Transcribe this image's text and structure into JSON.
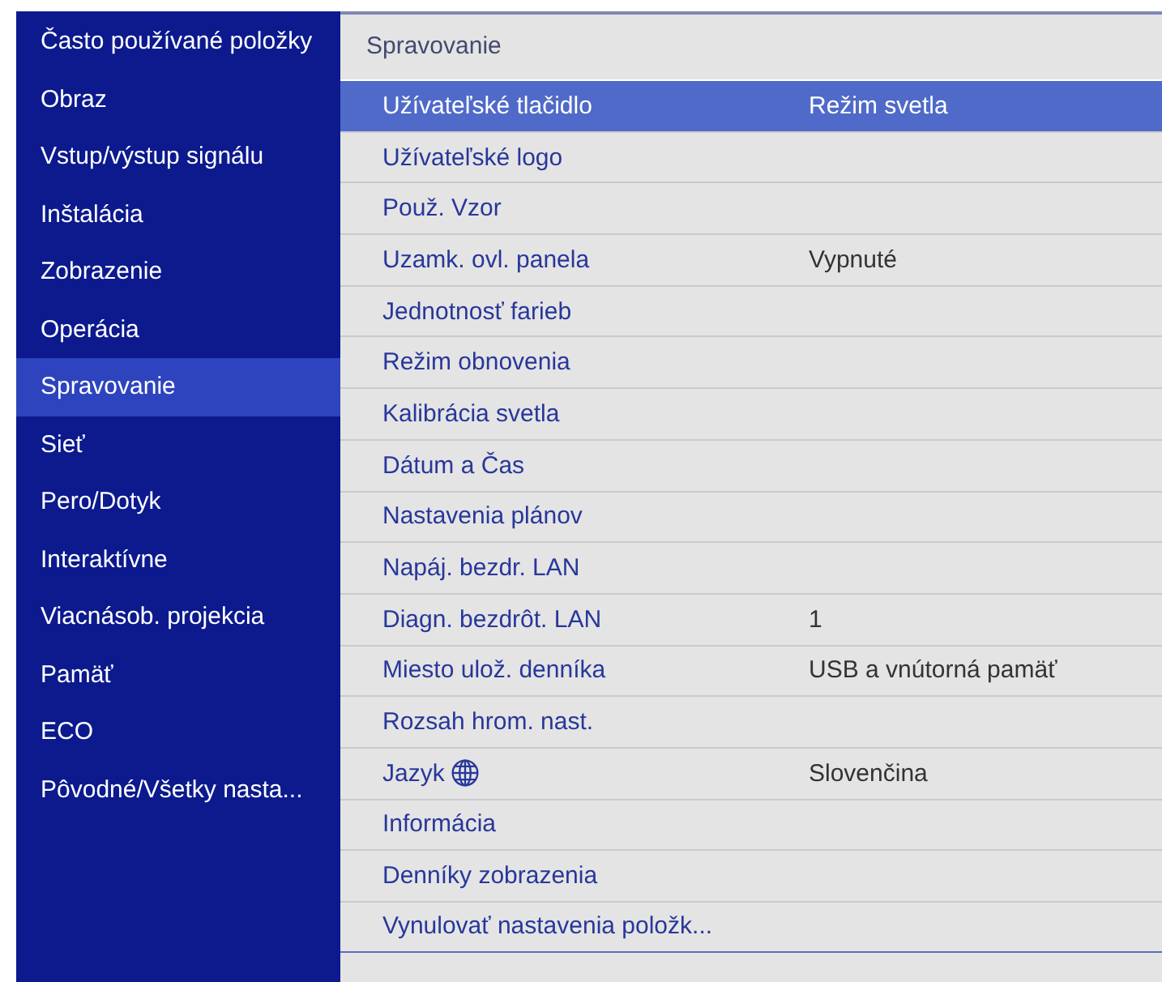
{
  "sidebar": {
    "items": [
      {
        "label": "Často používané položky",
        "selected": false
      },
      {
        "label": "Obraz",
        "selected": false
      },
      {
        "label": "Vstup/výstup signálu",
        "selected": false
      },
      {
        "label": "Inštalácia",
        "selected": false
      },
      {
        "label": "Zobrazenie",
        "selected": false
      },
      {
        "label": "Operácia",
        "selected": false
      },
      {
        "label": "Spravovanie",
        "selected": true
      },
      {
        "label": "Sieť",
        "selected": false
      },
      {
        "label": "Pero/Dotyk",
        "selected": false
      },
      {
        "label": "Interaktívne",
        "selected": false
      },
      {
        "label": "Viacnásob. projekcia",
        "selected": false
      },
      {
        "label": "Pamäť",
        "selected": false
      },
      {
        "label": "ECO",
        "selected": false
      },
      {
        "label": "Pôvodné/Všetky nasta...",
        "selected": false
      }
    ]
  },
  "panel": {
    "title": "Spravovanie",
    "rows": [
      {
        "kind": "plain",
        "label": "Užívateľské tlačidlo",
        "value": "Režim svetla",
        "selected": true
      },
      {
        "kind": "plain",
        "label": "Užívateľské logo",
        "selected": false
      },
      {
        "kind": "plain",
        "label": "Použ. Vzor",
        "selected": false
      },
      {
        "kind": "plain",
        "label": "Uzamk. ovl. panela",
        "value": "Vypnuté",
        "selected": false
      },
      {
        "kind": "plain",
        "label": "Jednotnosť farieb",
        "selected": false
      },
      {
        "kind": "plain",
        "label": "Režim obnovenia",
        "selected": false
      },
      {
        "kind": "plain",
        "label": "Kalibrácia svetla",
        "selected": false
      },
      {
        "kind": "plain",
        "label": "Dátum a Čas",
        "selected": false
      },
      {
        "kind": "plain",
        "label": "Nastavenia plánov",
        "selected": false
      },
      {
        "kind": "plain",
        "label": "Napáj. bezdr. LAN",
        "selected": false
      },
      {
        "kind": "plain",
        "label": "Diagn. bezdrôt. LAN",
        "value": "1",
        "selected": false
      },
      {
        "kind": "plain",
        "label": "Miesto ulož. denníka",
        "value": "USB a vnútorná pamäť",
        "selected": false
      },
      {
        "kind": "plain",
        "label": "Rozsah hrom. nast.",
        "selected": false
      },
      {
        "kind": "language",
        "label": "Jazyk",
        "value": "Slovenčina",
        "selected": false
      },
      {
        "kind": "plain",
        "label": "Informácia",
        "selected": false
      },
      {
        "kind": "plain",
        "label": "Denníky zobrazenia",
        "selected": false
      },
      {
        "kind": "plain",
        "label": "Vynulovať nastavenia položk...",
        "selected": false
      }
    ]
  }
}
